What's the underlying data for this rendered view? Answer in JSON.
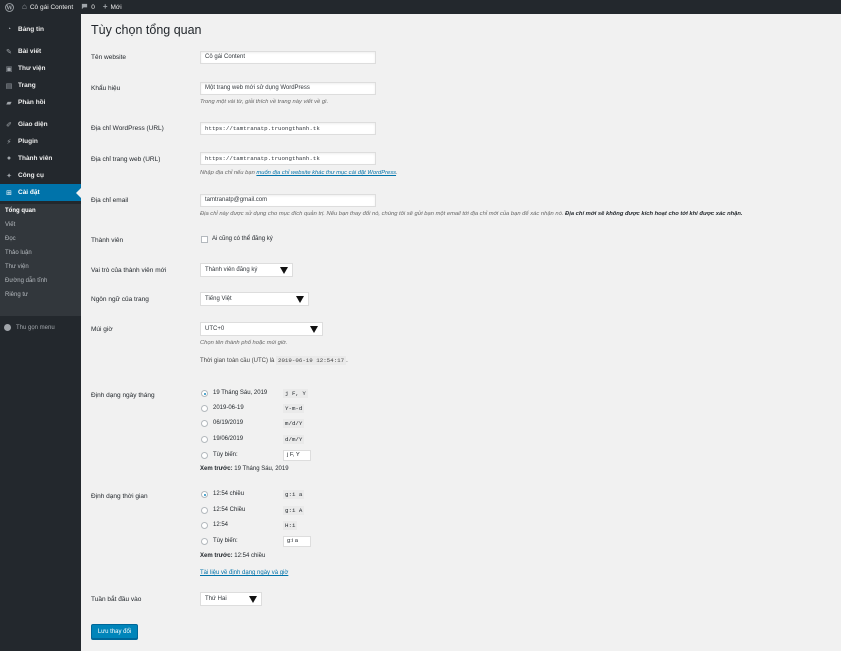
{
  "adminbar": {
    "site_name": "Cô gái Content",
    "comments_count": "0",
    "new_label": "Mới"
  },
  "sidebar": {
    "items": [
      {
        "label": "Bảng tin",
        "icon": "dashboard-icon"
      },
      {
        "label": "Bài viết",
        "icon": "pin-icon"
      },
      {
        "label": "Thư viện",
        "icon": "media-icon"
      },
      {
        "label": "Trang",
        "icon": "page-icon"
      },
      {
        "label": "Phản hồi",
        "icon": "comment-icon"
      },
      {
        "label": "Giao diện",
        "icon": "brush-icon"
      },
      {
        "label": "Plugin",
        "icon": "plugin-icon"
      },
      {
        "label": "Thành viên",
        "icon": "user-icon"
      },
      {
        "label": "Công cụ",
        "icon": "wrench-icon"
      },
      {
        "label": "Cài đặt",
        "icon": "settings-icon"
      }
    ],
    "submenu": [
      "Tổng quan",
      "Viết",
      "Đọc",
      "Thảo luận",
      "Thư viện",
      "Đường dẫn tĩnh",
      "Riêng tư"
    ],
    "collapse_label": "Thu gọn menu"
  },
  "page": {
    "title": "Tùy chọn tổng quan"
  },
  "form": {
    "site_title": {
      "label": "Tên website",
      "value": "Cô gái Content"
    },
    "tagline": {
      "label": "Khẩu hiệu",
      "value": "Một trang web mới sử dụng WordPress",
      "desc": "Trong một vài từ, giải thích về trang này viết về gì."
    },
    "wp_url": {
      "label": "Địa chỉ WordPress (URL)",
      "value": "https://tamtranatp.truongthanh.tk"
    },
    "site_url": {
      "label": "Địa chỉ trang web (URL)",
      "value": "https://tamtranatp.truongthanh.tk",
      "desc_before": "Nhập địa chỉ nếu bạn ",
      "desc_link": "muốn địa chỉ website khác thư mục cài đặt WordPress",
      "desc_after": "."
    },
    "email": {
      "label": "Địa chỉ email",
      "value": "tamtranatp@gmail.com",
      "desc": "Địa chỉ này được sử dụng cho mục đích quản trị. Nếu bạn thay đổi nó, chúng tôi sẽ gửi bạn một email tới địa chỉ mới của bạn để xác nhận nó. ",
      "desc_bold": "Địa chỉ mới sẽ không được kích hoạt cho tới khi được xác nhận."
    },
    "membership": {
      "label": "Thành viên",
      "checkbox_label": "Ai cũng có thể đăng ký"
    },
    "default_role": {
      "label": "Vai trò của thành viên mới",
      "value": "Thành viên đăng ký"
    },
    "language": {
      "label": "Ngôn ngữ của trang",
      "value": "Tiếng Việt"
    },
    "timezone": {
      "label": "Múi giờ",
      "value": "UTC+0",
      "desc": "Chọn tên thành phố hoặc múi giờ.",
      "utc_label": "Thời gian toàn cầu (UTC) là",
      "utc_value": "2019-06-19 12:54:17",
      "utc_suffix": "."
    },
    "date_format": {
      "label": "Định dạng ngày tháng",
      "options": [
        {
          "label": "19 Tháng Sáu, 2019",
          "code": "j F, Y"
        },
        {
          "label": "2019-06-19",
          "code": "Y-m-d"
        },
        {
          "label": "06/19/2019",
          "code": "m/d/Y"
        },
        {
          "label": "19/06/2019",
          "code": "d/m/Y"
        }
      ],
      "custom_label": "Tùy biến:",
      "custom_value": "j F, Y",
      "preview_label": "Xem trước:",
      "preview_value": " 19 Tháng Sáu, 2019"
    },
    "time_format": {
      "label": "Định dạng thời gian",
      "options": [
        {
          "label": "12:54 chiều",
          "code": "g:i a"
        },
        {
          "label": "12:54 Chiều",
          "code": "g:i A"
        },
        {
          "label": "12:54",
          "code": "H:i"
        }
      ],
      "custom_label": "Tùy biến:",
      "custom_value": "g:i a",
      "preview_label": "Xem trước:",
      "preview_value": " 12:54 chiều",
      "doc_link": "Tài liệu về định dạng ngày và giờ"
    },
    "week_start": {
      "label": "Tuần bắt đầu vào",
      "value": "Thứ Hai"
    },
    "save_label": "Lưu thay đổi"
  }
}
